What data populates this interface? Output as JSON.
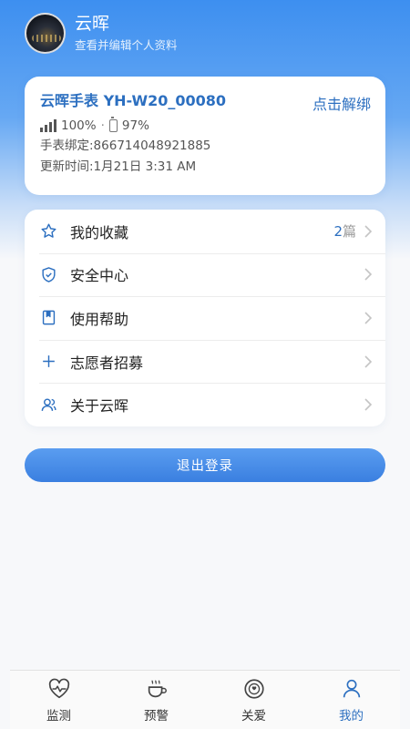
{
  "profile": {
    "name": "云晖",
    "subtitle": "查看并编辑个人资料"
  },
  "device": {
    "title": "云晖手表 YH-W20_00080",
    "unbind_label": "点击解绑",
    "signal_text": "100%",
    "separator": "·",
    "battery_text": "97%",
    "binding_line": "手表绑定:866714048921885",
    "update_line": "更新时间:1月21日 3:31 AM"
  },
  "menu": {
    "items": [
      {
        "label": "我的收藏",
        "icon": "star-icon",
        "count_num": "2",
        "count_unit": "篇"
      },
      {
        "label": "安全中心",
        "icon": "shield-icon"
      },
      {
        "label": "使用帮助",
        "icon": "book-icon"
      },
      {
        "label": "志愿者招募",
        "icon": "plus-icon"
      },
      {
        "label": "关于云晖",
        "icon": "users-icon"
      }
    ]
  },
  "logout_label": "退出登录",
  "tabs": [
    {
      "label": "监测",
      "icon": "heart-pulse-icon",
      "active": false
    },
    {
      "label": "预警",
      "icon": "cup-icon",
      "active": false
    },
    {
      "label": "关爱",
      "icon": "care-icon",
      "active": false
    },
    {
      "label": "我的",
      "icon": "person-icon",
      "active": true
    }
  ],
  "colors": {
    "accent": "#2c6fc0",
    "header_top": "#3d8ff0",
    "logout_button": "#3a7fe0"
  }
}
